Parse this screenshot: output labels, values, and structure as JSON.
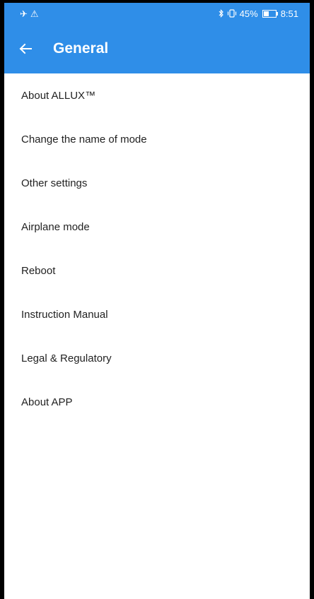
{
  "status_bar": {
    "left_icons": [
      "airplane-icon",
      "warning-icon"
    ],
    "left_glyphs": [
      "✈",
      "⚠"
    ],
    "battery_text": "45%",
    "battery_level": 0.45,
    "time": "8:51",
    "right_icons": [
      "bluetooth-icon",
      "vibrate-icon",
      "battery-icon"
    ]
  },
  "app_bar": {
    "title": "General",
    "back_icon": "arrow-left-icon"
  },
  "menu": {
    "items": [
      {
        "label": "About ALLUX™"
      },
      {
        "label": "Change the name of mode"
      },
      {
        "label": "Other settings"
      },
      {
        "label": "Airplane mode"
      },
      {
        "label": "Reboot"
      },
      {
        "label": "Instruction Manual"
      },
      {
        "label": "Legal & Regulatory"
      },
      {
        "label": "About APP"
      }
    ]
  },
  "colors": {
    "accent": "#2f8ee8",
    "text": "#222222",
    "background": "#ffffff"
  }
}
